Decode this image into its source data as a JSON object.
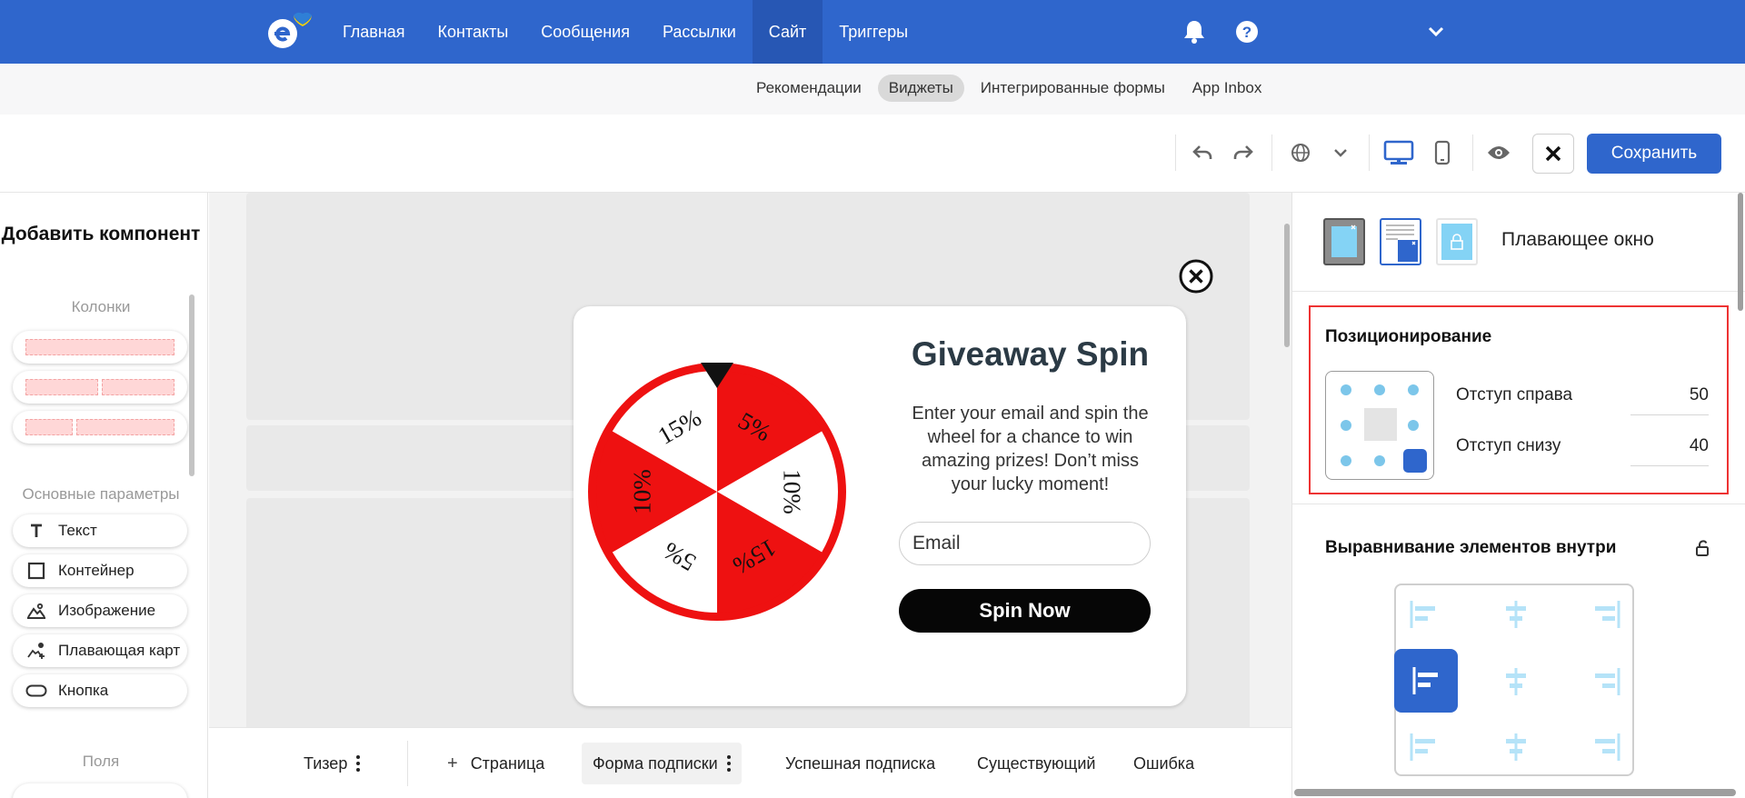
{
  "topnav": {
    "items": [
      {
        "label": "Главная"
      },
      {
        "label": "Контакты"
      },
      {
        "label": "Сообщения"
      },
      {
        "label": "Рассылки"
      },
      {
        "label": "Сайт"
      },
      {
        "label": "Триггеры"
      }
    ],
    "active_index": 4,
    "icons": [
      "bell-icon",
      "help-icon",
      "chevron-down-icon"
    ]
  },
  "subnav": {
    "items": [
      {
        "label": "Рекомендации"
      },
      {
        "label": "Виджеты"
      },
      {
        "label": "Интегрированные формы"
      },
      {
        "label": "App Inbox"
      }
    ],
    "active_index": 1
  },
  "toolbar": {
    "icons": [
      "undo-icon",
      "redo-icon",
      "globe-icon",
      "chevron-down-icon",
      "desktop-icon",
      "mobile-icon",
      "eye-icon",
      "close-icon"
    ],
    "save_label": "Сохранить"
  },
  "left_panel": {
    "title": "Добавить компонент",
    "columns_label": "Колонки",
    "basic_label": "Основные параметры",
    "fields_label": "Поля",
    "components": [
      {
        "icon": "text-icon",
        "label": "Текст"
      },
      {
        "icon": "container-icon",
        "label": "Контейнер"
      },
      {
        "icon": "image-icon",
        "label": "Изображение"
      },
      {
        "icon": "floating-card-icon",
        "label": "Плавающая карт"
      },
      {
        "icon": "button-icon",
        "label": "Кнопка"
      }
    ]
  },
  "popup": {
    "title": "Giveaway Spin",
    "description": "Enter your email and spin the wheel for a chance to win amazing prizes! Don’t miss your lucky moment!",
    "email_placeholder": "Email",
    "button_label": "Spin Now",
    "wheel_segments": [
      "5%",
      "10%",
      "15%",
      "5%",
      "10%",
      "15%"
    ]
  },
  "bottom_tabs": {
    "teaser": "Тизер",
    "add_page": "Страница",
    "tabs": [
      "Форма подписки",
      "Успешная подписка",
      "Существующий",
      "Ошибка"
    ],
    "active_index": 0
  },
  "right_panel": {
    "floating_label": "Плавающее окно",
    "positioning": {
      "title": "Позиционирование",
      "right_offset_label": "Отступ справа",
      "right_offset_value": "50",
      "bottom_offset_label": "Отступ снизу",
      "bottom_offset_value": "40",
      "selected_anchor": "bottom-right"
    },
    "alignment_title": "Выравнивание элементов внутри",
    "alignment_selected": "middle-left"
  },
  "colors": {
    "brand_blue": "#2f66cc",
    "wheel_red": "#ee1111",
    "highlight_red": "#ee3333"
  }
}
